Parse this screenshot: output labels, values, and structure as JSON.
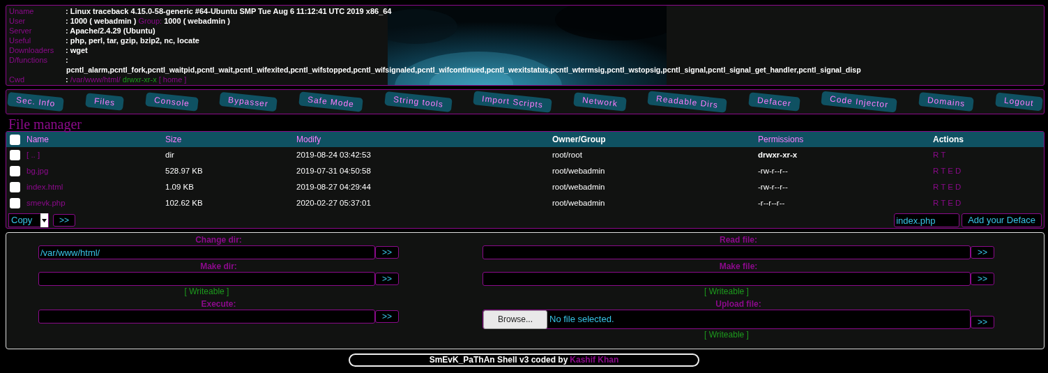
{
  "sysinfo": [
    {
      "kind": "text",
      "label": "Uname",
      "value": ": Linux traceback 4.15.0-58-generic #64-Ubuntu SMP Tue Aug 6 11:12:41 UTC 2019 x86_64"
    },
    {
      "kind": "user",
      "label": "User",
      "value": ": 1000 ( webadmin )",
      "group_label": "Group:",
      "group_value": "1000 ( webadmin )"
    },
    {
      "kind": "text",
      "label": "Server",
      "value": ": Apache/2.4.29 (Ubuntu)"
    },
    {
      "kind": "text",
      "label": "Useful",
      "value": ": php, perl, tar, gzip, bzip2, nc, locate"
    },
    {
      "kind": "text",
      "label": "Downloaders",
      "value": ": wget"
    },
    {
      "kind": "functions",
      "label": "D/functions",
      "value": ":",
      "list": "pcntl_alarm,pcntl_fork,pcntl_waitpid,pcntl_wait,pcntl_wifexited,pcntl_wifstopped,pcntl_wifsignaled,pcntl_wifcontinued,pcntl_wexitstatus,pcntl_wtermsig,pcntl_wstopsig,pcntl_signal,pcntl_signal_get_handler,pcntl_signal_disp"
    },
    {
      "kind": "cwd",
      "label": "Cwd",
      "value": ":",
      "path": "/var/www/html/",
      "perms": "drwxr-xr-x",
      "home": "[ home ]"
    }
  ],
  "tabs": [
    "Sec. Info",
    "Files",
    "Console",
    "Bypasser",
    "Safe Mode",
    "String tools",
    "Import Scripts",
    "Network",
    "Readable Dirs",
    "Defacer",
    "Code Injector",
    "Domains",
    "Logout"
  ],
  "file_manager": {
    "title": "File manager",
    "select_all": {
      "checked": false
    },
    "columns": [
      {
        "label": "Name",
        "link": true
      },
      {
        "label": "Size",
        "link": true
      },
      {
        "label": "Modify",
        "link": true
      },
      {
        "label": "Owner/Group",
        "link": false
      },
      {
        "label": "Permissions",
        "link": true
      },
      {
        "label": "Actions",
        "link": false
      }
    ],
    "rows": [
      {
        "checked": false,
        "name": "[ .. ]",
        "size": "dir",
        "modify": "2019-08-24 03:42:53",
        "owner": "root/root",
        "permissions": "drwxr-xr-x",
        "writable": true,
        "actions": [
          "R",
          "T"
        ]
      },
      {
        "checked": false,
        "name": "bg.jpg",
        "size": "528.97 KB",
        "modify": "2019-07-31 04:50:58",
        "owner": "root/webadmin",
        "permissions": "-rw-r--r--",
        "writable": false,
        "actions": [
          "R",
          "T",
          "E",
          "D"
        ]
      },
      {
        "checked": false,
        "name": "index.html",
        "size": "1.09 KB",
        "modify": "2019-08-27 04:29:44",
        "owner": "root/webadmin",
        "permissions": "-rw-r--r--",
        "writable": false,
        "actions": [
          "R",
          "T",
          "E",
          "D"
        ]
      },
      {
        "checked": false,
        "name": "smevk.php",
        "size": "102.62 KB",
        "modify": "2020-02-27 05:37:01",
        "owner": "root/webadmin",
        "permissions": "-r--r--r--",
        "writable": false,
        "actions": [
          "R",
          "T",
          "E",
          "D"
        ]
      }
    ],
    "bulk_action": "Copy",
    "go_button": ">>",
    "deface_file": "index.php",
    "deface_button": "Add your Deface"
  },
  "forms": [
    [
      {
        "kind": "text",
        "label": "Change dir:",
        "value": "/var/www/html/",
        "button": ">>"
      },
      {
        "kind": "text",
        "label": "Make dir:",
        "button": ">>",
        "note": "[ Writeable ]"
      },
      {
        "kind": "text",
        "label": "Execute:",
        "button": ">>"
      }
    ],
    [
      {
        "kind": "text",
        "label": "Read file:",
        "button": ">>"
      },
      {
        "kind": "text",
        "label": "Make file:",
        "button": ">>",
        "note": "[ Writeable ]"
      },
      {
        "kind": "upload",
        "label": "Upload file:",
        "browse": "Browse...",
        "file_status": "No file selected.",
        "button": ">>",
        "note": "[ Writeable ]"
      }
    ]
  ],
  "footer": {
    "text": "SmEvK_PaThAn Shell v3 coded by",
    "author": "Kashif Khan"
  }
}
